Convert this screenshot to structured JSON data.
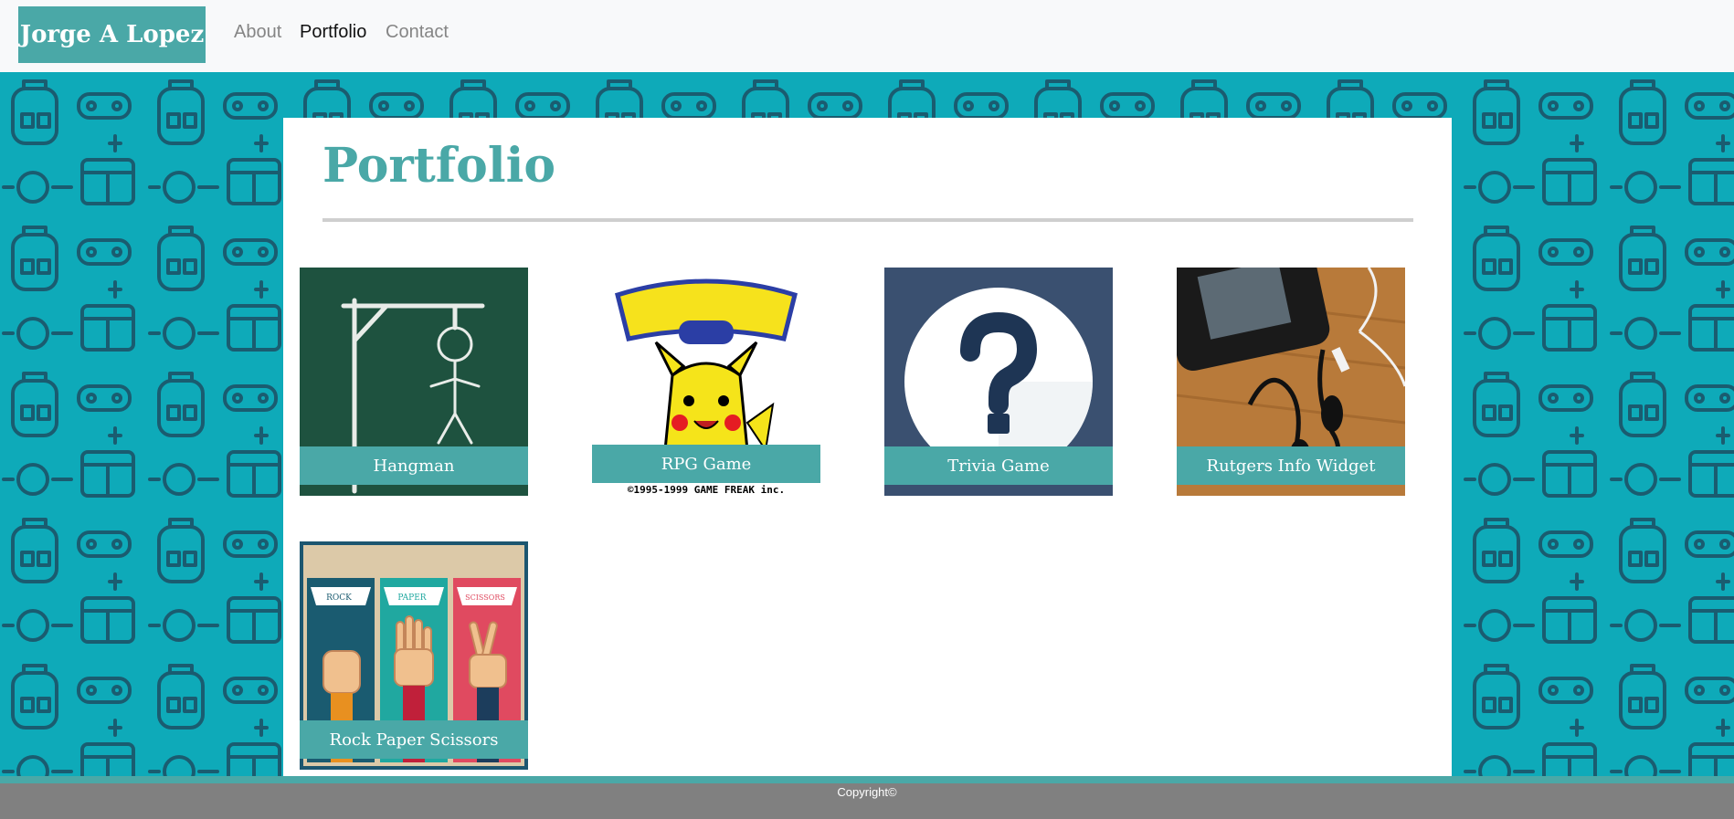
{
  "navbar": {
    "brand": "Jorge A Lopez",
    "links": [
      {
        "label": "About"
      },
      {
        "label": "Portfolio"
      },
      {
        "label": "Contact"
      }
    ]
  },
  "main": {
    "title": "Portfolio",
    "projects": [
      {
        "label": "Hangman",
        "image": "hangman-chalkboard"
      },
      {
        "label": "RPG Game",
        "image": "pokemon-yellow-logo",
        "caption": "©1995-1999 GAME FREAK inc."
      },
      {
        "label": "Trivia Game",
        "image": "question-mark-icon"
      },
      {
        "label": "Rutgers Info Widget",
        "image": "phone-earbuds-photo"
      },
      {
        "label": "Rock Paper Scissors",
        "image": "rock-paper-scissors-hands",
        "panel_titles": [
          "ROCK",
          "PAPER",
          "SCISSORS"
        ]
      }
    ]
  },
  "footer": {
    "copyright": "Copyright©"
  },
  "colors": {
    "accent": "#4aa8a7",
    "background_pattern": "#0eaab9",
    "footer": "#808080"
  }
}
